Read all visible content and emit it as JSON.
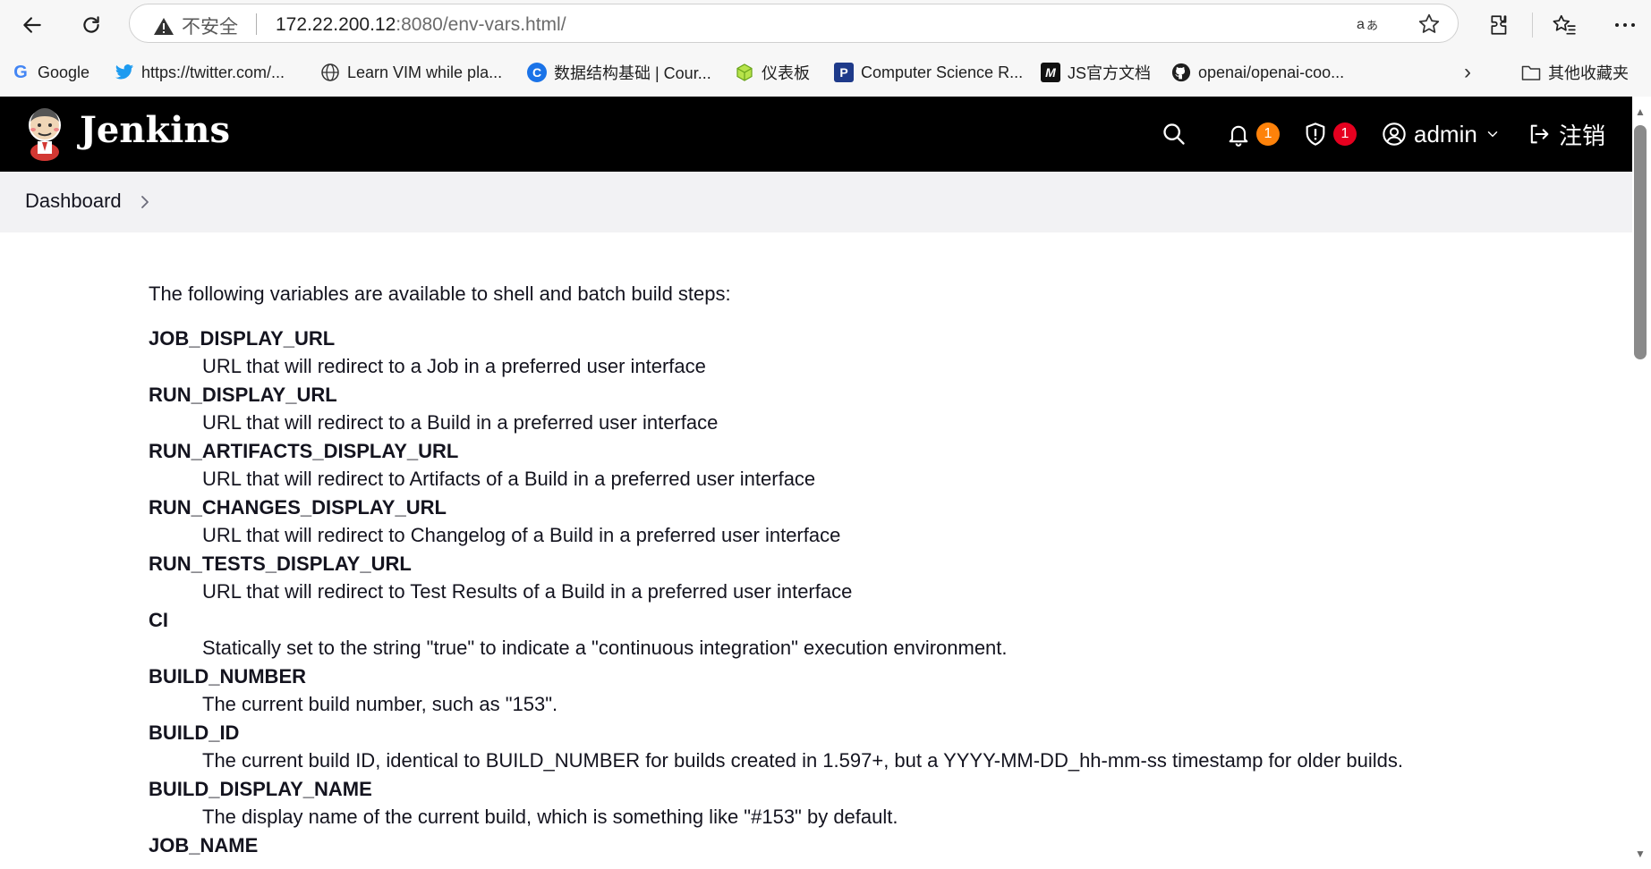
{
  "browser": {
    "security_label": "不安全",
    "url_host": "172.22.200.12",
    "url_rest": ":8080/env-vars.html/",
    "bookmarks": [
      {
        "label": "Google",
        "icon": "google-icon"
      },
      {
        "label": "https://twitter.com/...",
        "icon": "twitter-icon"
      },
      {
        "label": "Learn VIM while pla...",
        "icon": "globe-icon"
      },
      {
        "label": "数据结构基础 | Cour...",
        "icon": "course-icon"
      },
      {
        "label": "仪表板",
        "icon": "cube-icon"
      },
      {
        "label": "Computer Science R...",
        "icon": "p-icon"
      },
      {
        "label": "JS官方文档",
        "icon": "m-icon"
      },
      {
        "label": "openai/openai-coo...",
        "icon": "github-icon"
      }
    ],
    "other_bookmarks": "其他收藏夹",
    "more_bookmarks_chevron": "›"
  },
  "jenkins": {
    "brand": "Jenkins",
    "notifications_count": "1",
    "security_count": "1",
    "user": "admin",
    "logout": "注销",
    "colors": {
      "header_bg": "#000000",
      "notif_badge": "#fe820a",
      "security_badge": "#e6001f"
    }
  },
  "breadcrumb": {
    "dashboard": "Dashboard"
  },
  "content": {
    "intro": "The following variables are available to shell and batch build steps:",
    "variables": [
      {
        "name": "JOB_DISPLAY_URL",
        "desc": "URL that will redirect to a Job in a preferred user interface"
      },
      {
        "name": "RUN_DISPLAY_URL",
        "desc": "URL that will redirect to a Build in a preferred user interface"
      },
      {
        "name": "RUN_ARTIFACTS_DISPLAY_URL",
        "desc": "URL that will redirect to Artifacts of a Build in a preferred user interface"
      },
      {
        "name": "RUN_CHANGES_DISPLAY_URL",
        "desc": "URL that will redirect to Changelog of a Build in a preferred user interface"
      },
      {
        "name": "RUN_TESTS_DISPLAY_URL",
        "desc": "URL that will redirect to Test Results of a Build in a preferred user interface"
      },
      {
        "name": "CI",
        "desc": "Statically set to the string \"true\" to indicate a \"continuous integration\" execution environment."
      },
      {
        "name": "BUILD_NUMBER",
        "desc": "The current build number, such as \"153\"."
      },
      {
        "name": "BUILD_ID",
        "desc": "The current build ID, identical to BUILD_NUMBER for builds created in 1.597+, but a YYYY-MM-DD_hh-mm-ss timestamp for older builds."
      },
      {
        "name": "BUILD_DISPLAY_NAME",
        "desc": "The display name of the current build, which is something like \"#153\" by default."
      },
      {
        "name": "JOB_NAME",
        "desc": ""
      }
    ]
  }
}
